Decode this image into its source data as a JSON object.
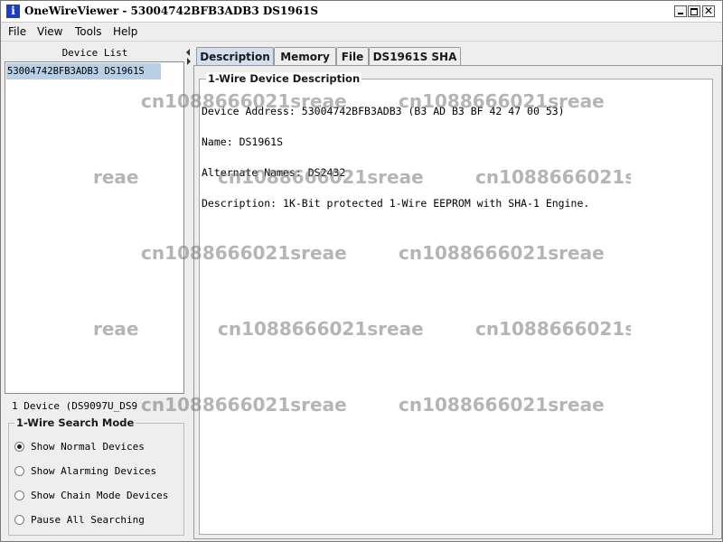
{
  "window": {
    "title": "OneWireViewer - 53004742BFB3ADB3 DS1961S",
    "app_icon_glyph": "i",
    "controls": {
      "minimize": "minimize-icon",
      "maximize": "maximize-icon",
      "close_glyph": "✕"
    }
  },
  "menu": {
    "items": [
      "File",
      "View",
      "Tools",
      "Help"
    ]
  },
  "device_list": {
    "header": "Device List",
    "items": [
      "53004742BFB3ADB3 DS1961S"
    ],
    "count_text": "1 Device  (DS9097U_DS9"
  },
  "search_mode": {
    "title": "1-Wire Search Mode",
    "options": [
      {
        "label": "Show Normal Devices",
        "checked": true
      },
      {
        "label": "Show Alarming Devices",
        "checked": false
      },
      {
        "label": "Show Chain Mode Devices",
        "checked": false
      },
      {
        "label": "Pause All Searching",
        "checked": false
      }
    ]
  },
  "tabs": [
    {
      "label": "Description",
      "active": true
    },
    {
      "label": "Memory",
      "active": false
    },
    {
      "label": "File",
      "active": false
    },
    {
      "label": "DS1961S SHA",
      "active": false
    }
  ],
  "description": {
    "group_title": "1-Wire Device Description",
    "address_label": "Device Address:",
    "address_value": "53004742BFB3ADB3 (B3 AD B3 BF 42 47 00 53)",
    "name_label": "Name:",
    "name_value": "DS1961S",
    "alt_label": "Alternate Names:",
    "alt_value": "DS2432",
    "desc_label": "Description:",
    "desc_value": "1K-Bit protected 1-Wire EEPROM with SHA-1 Engine."
  },
  "watermark_text": "cn1088666021sreae",
  "watermark_fragment": "reae",
  "colors": {
    "selection": "#b8cfe5",
    "active_tab": "#d2dff0",
    "app_icon": "#1d3fbf"
  }
}
